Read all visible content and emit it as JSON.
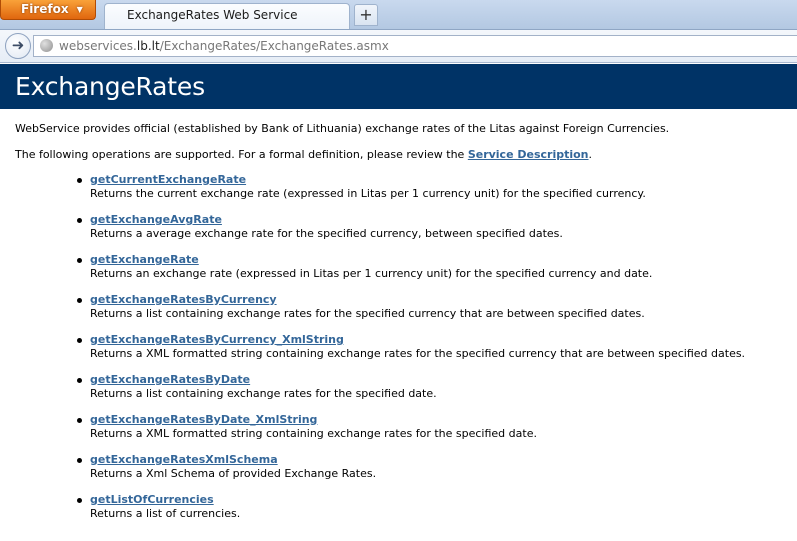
{
  "browser": {
    "menu_button": "Firefox",
    "tab_title": "ExchangeRates Web Service",
    "new_tab_symbol": "+",
    "url_prefix": "webservices.",
    "url_domain": "lb.lt",
    "url_path": "/ExchangeRates/ExchangeRates.asmx"
  },
  "page": {
    "title": "ExchangeRates",
    "intro": "WebService provides official (established by Bank of Lithuania) exchange rates of the Litas against Foreign Currencies.",
    "operations_text": "The following operations are supported. For a formal definition, please review the",
    "service_description_link": "Service Description",
    "operations_text_end": "."
  },
  "operations": [
    {
      "name": "getCurrentExchangeRate",
      "description": "Returns the current exchange rate (expressed in Litas per 1 currency unit) for the specified currency."
    },
    {
      "name": "getExchangeAvgRate",
      "description": "Returns a average exchange rate for the specified currency, between specified dates."
    },
    {
      "name": "getExchangeRate",
      "description": "Returns an exchange rate (expressed in Litas per 1 currency unit) for the specified currency and date."
    },
    {
      "name": "getExchangeRatesByCurrency",
      "description": "Returns a list containing exchange rates for the specified currency that are between specified dates."
    },
    {
      "name": "getExchangeRatesByCurrency_XmlString",
      "description": "Returns a XML formatted string containing exchange rates for the specified currency that are between specified dates."
    },
    {
      "name": "getExchangeRatesByDate",
      "description": "Returns a list containing exchange rates for the specified date."
    },
    {
      "name": "getExchangeRatesByDate_XmlString",
      "description": "Returns a XML formatted string containing exchange rates for the specified date."
    },
    {
      "name": "getExchangeRatesXmlSchema",
      "description": "Returns a Xml Schema of provided Exchange Rates."
    },
    {
      "name": "getListOfCurrencies",
      "description": "Returns a list of currencies."
    }
  ],
  "colors": {
    "header_bg": "#003366",
    "link": "#336699"
  }
}
